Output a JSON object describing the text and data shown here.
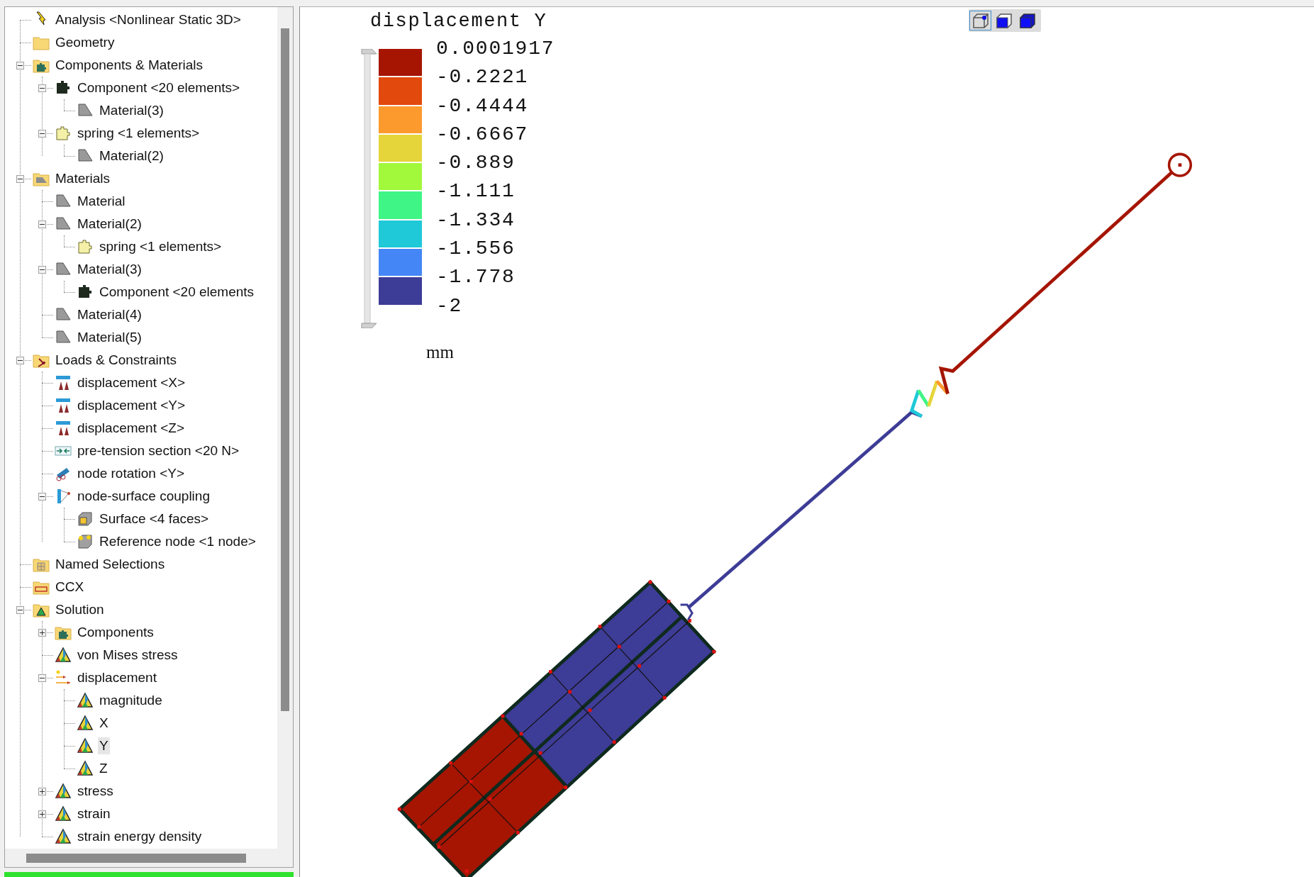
{
  "tree": [
    {
      "label": "Analysis <Nonlinear Static 3D>",
      "kind": "analysis",
      "selected": false
    },
    {
      "label": "Geometry",
      "kind": "folder",
      "selected": false
    },
    {
      "label": "Components & Materials",
      "kind": "folder-components",
      "selected": false,
      "expanded": true,
      "children": [
        {
          "label": "Component <20 elements>",
          "kind": "component",
          "selected": false,
          "expanded": true,
          "children": [
            {
              "label": "Material(3)",
              "kind": "material",
              "selected": false
            }
          ]
        },
        {
          "label": "spring <1 elements>",
          "kind": "spring",
          "selected": false,
          "expanded": true,
          "children": [
            {
              "label": "Material(2)",
              "kind": "material",
              "selected": false
            }
          ]
        }
      ]
    },
    {
      "label": "Materials",
      "kind": "folder-materials",
      "selected": false,
      "expanded": true,
      "children": [
        {
          "label": "Material",
          "kind": "material",
          "selected": false
        },
        {
          "label": "Material(2)",
          "kind": "material",
          "selected": false,
          "expanded": true,
          "children": [
            {
              "label": "spring <1 elements>",
              "kind": "spring",
              "selected": false
            }
          ]
        },
        {
          "label": "Material(3)",
          "kind": "material",
          "selected": false,
          "expanded": true,
          "children": [
            {
              "label": "Component <20 elements",
              "kind": "component",
              "selected": false
            }
          ]
        },
        {
          "label": "Material(4)",
          "kind": "material",
          "selected": false
        },
        {
          "label": "Material(5)",
          "kind": "material",
          "selected": false
        }
      ]
    },
    {
      "label": "Loads & Constraints",
      "kind": "folder-loads",
      "selected": false,
      "expanded": true,
      "children": [
        {
          "label": "displacement <X>",
          "kind": "constraint",
          "selected": false
        },
        {
          "label": "displacement <Y>",
          "kind": "constraint",
          "selected": false
        },
        {
          "label": "displacement <Z>",
          "kind": "constraint",
          "selected": false
        },
        {
          "label": "pre-tension section <20 N>",
          "kind": "pretension",
          "selected": false
        },
        {
          "label": "node rotation <Y>",
          "kind": "rotation",
          "selected": false
        },
        {
          "label": "node-surface coupling",
          "kind": "coupling",
          "selected": false,
          "expanded": true,
          "children": [
            {
              "label": "Surface <4 faces>",
              "kind": "surface",
              "selected": false
            },
            {
              "label": "Reference node <1 node>",
              "kind": "refnode",
              "selected": false
            }
          ]
        }
      ]
    },
    {
      "label": "Named Selections",
      "kind": "folder-named",
      "selected": false
    },
    {
      "label": "CCX",
      "kind": "folder-ccx",
      "selected": false
    },
    {
      "label": "Solution",
      "kind": "folder-solution",
      "selected": false,
      "expanded": true,
      "children": [
        {
          "label": "Components",
          "kind": "folder-components",
          "selected": false,
          "expanded": false
        },
        {
          "label": "von Mises stress",
          "kind": "result",
          "selected": false
        },
        {
          "label": "displacement",
          "kind": "displacement",
          "selected": false,
          "expanded": true,
          "children": [
            {
              "label": "magnitude",
              "kind": "result",
              "selected": false
            },
            {
              "label": "X",
              "kind": "result",
              "selected": false
            },
            {
              "label": "Y",
              "kind": "result",
              "selected": true
            },
            {
              "label": "Z",
              "kind": "result",
              "selected": false
            }
          ]
        },
        {
          "label": "stress",
          "kind": "result",
          "selected": false,
          "expanded": false
        },
        {
          "label": "strain",
          "kind": "result",
          "selected": false,
          "expanded": false
        },
        {
          "label": "strain energy density",
          "kind": "result",
          "selected": false
        }
      ]
    }
  ],
  "legend": {
    "title": "displacement Y",
    "bands": [
      {
        "color": "#a51502"
      },
      {
        "color": "#e2490c"
      },
      {
        "color": "#fd9a2e"
      },
      {
        "color": "#e5d53a"
      },
      {
        "color": "#a2f83b"
      },
      {
        "color": "#3ff586"
      },
      {
        "color": "#1fc9d8"
      },
      {
        "color": "#4586f6"
      },
      {
        "color": "#3d3c96"
      }
    ],
    "ticks": [
      "0.0001917",
      "-0.2221",
      "-0.4444",
      "-0.6667",
      "-0.889",
      "-1.111",
      "-1.334",
      "-1.556",
      "-1.778",
      "-2"
    ],
    "unit": "mm"
  },
  "view_buttons": [
    {
      "kind": "wireframe",
      "selected": true
    },
    {
      "kind": "solid-edges",
      "selected": false
    },
    {
      "kind": "solid",
      "selected": false
    }
  ],
  "progress": {
    "level": 1
  }
}
